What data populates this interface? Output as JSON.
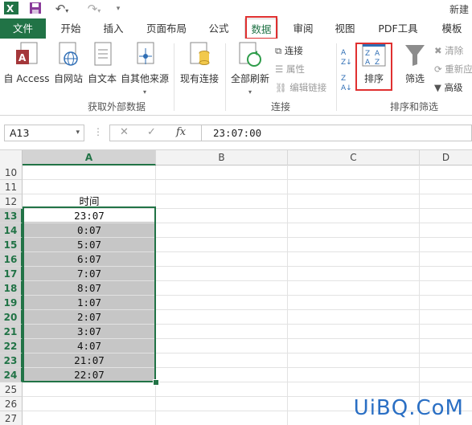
{
  "window": {
    "title": "新建"
  },
  "quick_access": {
    "excel_icon": "excel-logo-icon",
    "save_icon": "save-icon",
    "undo_icon": "undo-icon",
    "redo_icon": "redo-icon"
  },
  "tabs": [
    {
      "label": "文件"
    },
    {
      "label": "开始"
    },
    {
      "label": "插入"
    },
    {
      "label": "页面布局"
    },
    {
      "label": "公式"
    },
    {
      "label": "数据"
    },
    {
      "label": "审阅"
    },
    {
      "label": "视图"
    },
    {
      "label": "PDF工具"
    },
    {
      "label": "模板"
    }
  ],
  "ribbon": {
    "get_external": {
      "label": "获取外部数据",
      "buttons": [
        {
          "label": "自 Access"
        },
        {
          "label": "自网站"
        },
        {
          "label": "自文本"
        },
        {
          "label": "自其他来源"
        },
        {
          "label": "现有连接"
        }
      ]
    },
    "connections": {
      "label": "连接",
      "refresh_all": "全部刷新",
      "items": [
        {
          "label": "连接"
        },
        {
          "label": "属性"
        },
        {
          "label": "编辑链接"
        }
      ]
    },
    "sort_filter": {
      "label": "排序和筛选",
      "sort": "排序",
      "filter": "筛选",
      "items": [
        {
          "label": "清除"
        },
        {
          "label": "重新应用"
        },
        {
          "label": "高级"
        }
      ]
    }
  },
  "formula_bar": {
    "name_box": "A13",
    "cancel": "✕",
    "enter": "✓",
    "fx": "fx",
    "value": "23:07:00"
  },
  "sheet": {
    "columns": [
      "A",
      "B",
      "C",
      "D"
    ],
    "rows": [
      {
        "num": "10",
        "a": ""
      },
      {
        "num": "11",
        "a": ""
      },
      {
        "num": "12",
        "a": "时间"
      },
      {
        "num": "13",
        "a": "23:07"
      },
      {
        "num": "14",
        "a": "0:07"
      },
      {
        "num": "15",
        "a": "5:07"
      },
      {
        "num": "16",
        "a": "6:07"
      },
      {
        "num": "17",
        "a": "7:07"
      },
      {
        "num": "18",
        "a": "8:07"
      },
      {
        "num": "19",
        "a": "1:07"
      },
      {
        "num": "20",
        "a": "2:07"
      },
      {
        "num": "21",
        "a": "3:07"
      },
      {
        "num": "22",
        "a": "4:07"
      },
      {
        "num": "23",
        "a": "21:07"
      },
      {
        "num": "24",
        "a": "22:07"
      },
      {
        "num": "25",
        "a": ""
      },
      {
        "num": "26",
        "a": ""
      },
      {
        "num": "27",
        "a": ""
      }
    ]
  },
  "watermark": "UiBQ.CoM",
  "colors": {
    "excel_green": "#217346",
    "highlight_red": "#e03030",
    "selection_gray": "#c6c6c6"
  }
}
